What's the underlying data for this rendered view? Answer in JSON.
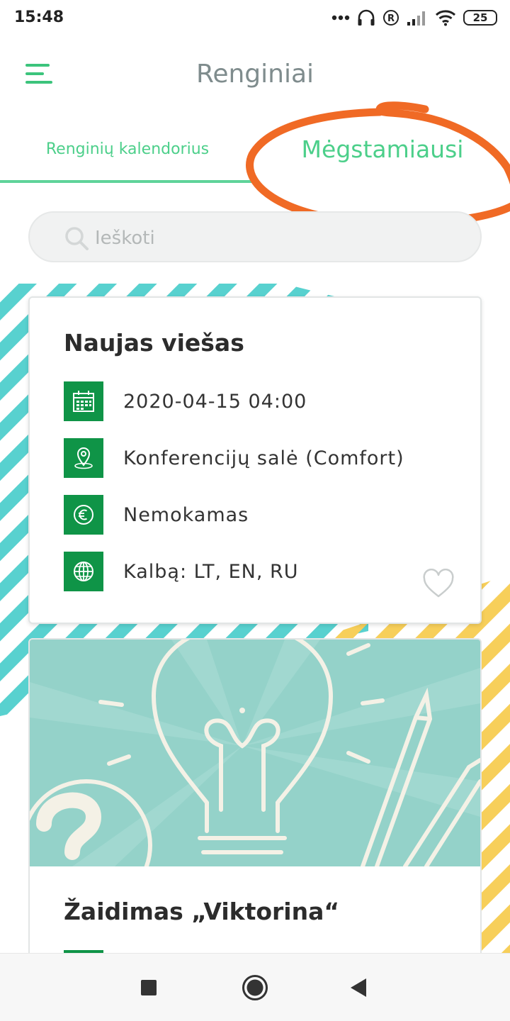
{
  "status_bar": {
    "time": "15:48",
    "battery": "25",
    "icons": [
      "more-dots-icon",
      "headphones-icon",
      "registered-icon",
      "signal-icon",
      "wifi-icon",
      "battery-icon"
    ]
  },
  "header": {
    "title": "Renginiai",
    "menu_icon": "hamburger-menu-icon"
  },
  "tabs": [
    {
      "label": "Renginių kalendorius",
      "active": true
    },
    {
      "label": "Mėgstamiausi",
      "active": false
    }
  ],
  "search": {
    "placeholder": "Ieškoti",
    "value": ""
  },
  "events": [
    {
      "title": "Naujas viešas",
      "date": "2020-04-15 04:00",
      "location": "Konferencijų salė (Comfort)",
      "price": "Nemokamas",
      "languages": "Kalbą: LT, EN, RU",
      "favorite": false
    },
    {
      "title": "Žaidimas „Viktorina“"
    }
  ],
  "colors": {
    "accent": "#4ccf8a",
    "icon_bg": "#0f9447",
    "annotation": "#f06a25",
    "stripe_teal": "#58d1cf",
    "stripe_yellow": "#f7cf5a",
    "image_bg": "#94d2c9"
  },
  "nav_bar": {
    "buttons": [
      "recents-square-icon",
      "home-circle-icon",
      "back-triangle-icon"
    ]
  }
}
